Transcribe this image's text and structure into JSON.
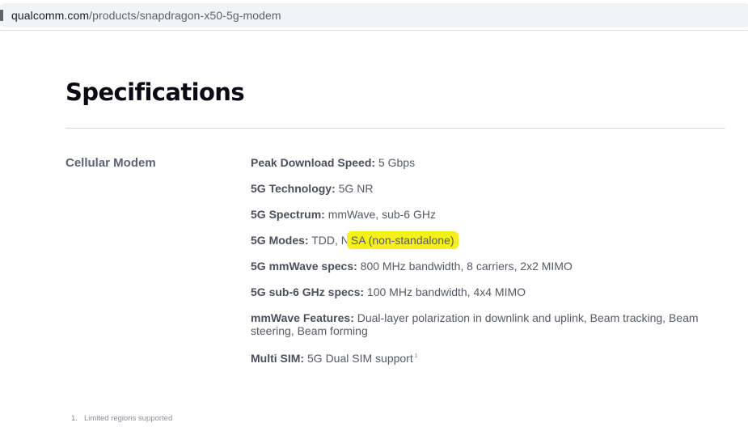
{
  "browser": {
    "url_domain": "qualcomm.com",
    "url_path": "/products/snapdragon-x50-5g-modem"
  },
  "page": {
    "title": "Specifications",
    "section_label": "Cellular Modem",
    "specs": [
      {
        "label": "Peak Download Speed:",
        "value": " 5 Gbps"
      },
      {
        "label": "5G Technology:",
        "value": " 5G NR"
      },
      {
        "label": "5G Spectrum:",
        "value": " mmWave, sub-6 GHz"
      },
      {
        "label": "5G Modes:",
        "value_before": " TDD, N",
        "value_highlight": "SA (non-standalone)"
      },
      {
        "label": "5G mmWave specs:",
        "value": " 800 MHz bandwidth, 8 carriers, 2x2 MIMO"
      },
      {
        "label": "5G sub-6 GHz specs:",
        "value": " 100 MHz bandwidth, 4x4 MIMO"
      },
      {
        "label": "mmWave Features:",
        "value": " Dual-layer polarization in downlink and uplink, Beam tracking, Beam steering, Beam forming"
      },
      {
        "label": "Multi SIM:",
        "value": " 5G Dual SIM support",
        "sup": "1"
      }
    ],
    "footnote": {
      "number": "1.",
      "text": "Limited regions supported"
    }
  },
  "colors": {
    "highlight": "#f6f01a",
    "title": "#0a0a14",
    "body_text": "#555a64"
  }
}
